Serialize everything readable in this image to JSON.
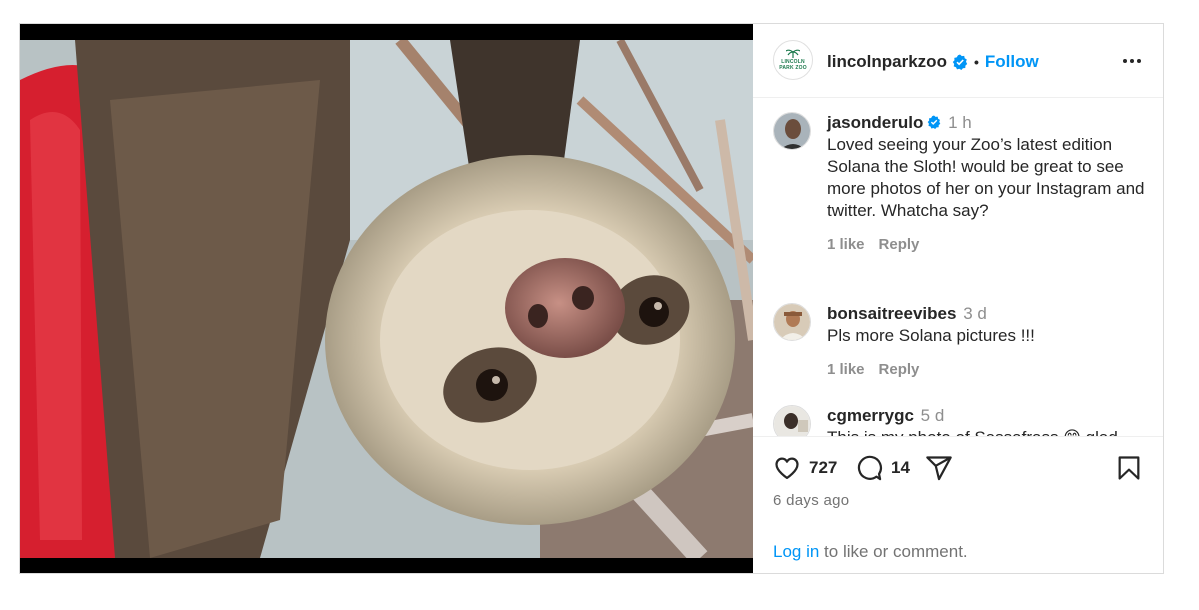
{
  "post": {
    "account": "lincolnparkzoo",
    "logo_text": [
      "LINCOLN",
      "PARK ZOO"
    ],
    "follow_label": "Follow",
    "separator": "•",
    "accent_color": "#0095f6",
    "verified_color": "#0095f6"
  },
  "comments": [
    {
      "user": "jasonderulo",
      "verified": true,
      "time": "1 h",
      "text": "Loved seeing your Zoo’s latest edition Solana the Sloth! would be great to see more photos of her on your Instagram and twitter. Whatcha say?",
      "likes": "1 like",
      "reply": "Reply"
    },
    {
      "user": "bonsaitreevibes",
      "verified": false,
      "time": "3 d",
      "text": "Pls more Solana pictures !!!",
      "likes": "1 like",
      "reply": "Reply"
    },
    {
      "user": "cgmerrygc",
      "verified": false,
      "time": "5 d",
      "text": "This is my photo of Sassafrass 😁 glad she is settling in well, we miss her!"
    }
  ],
  "actions": {
    "likes": "727",
    "comments": "14",
    "icons": [
      "heart-icon",
      "comment-icon",
      "share-icon",
      "bookmark-icon"
    ]
  },
  "date": "6 days ago",
  "login": {
    "link": "Log in",
    "rest": " to like or comment."
  }
}
